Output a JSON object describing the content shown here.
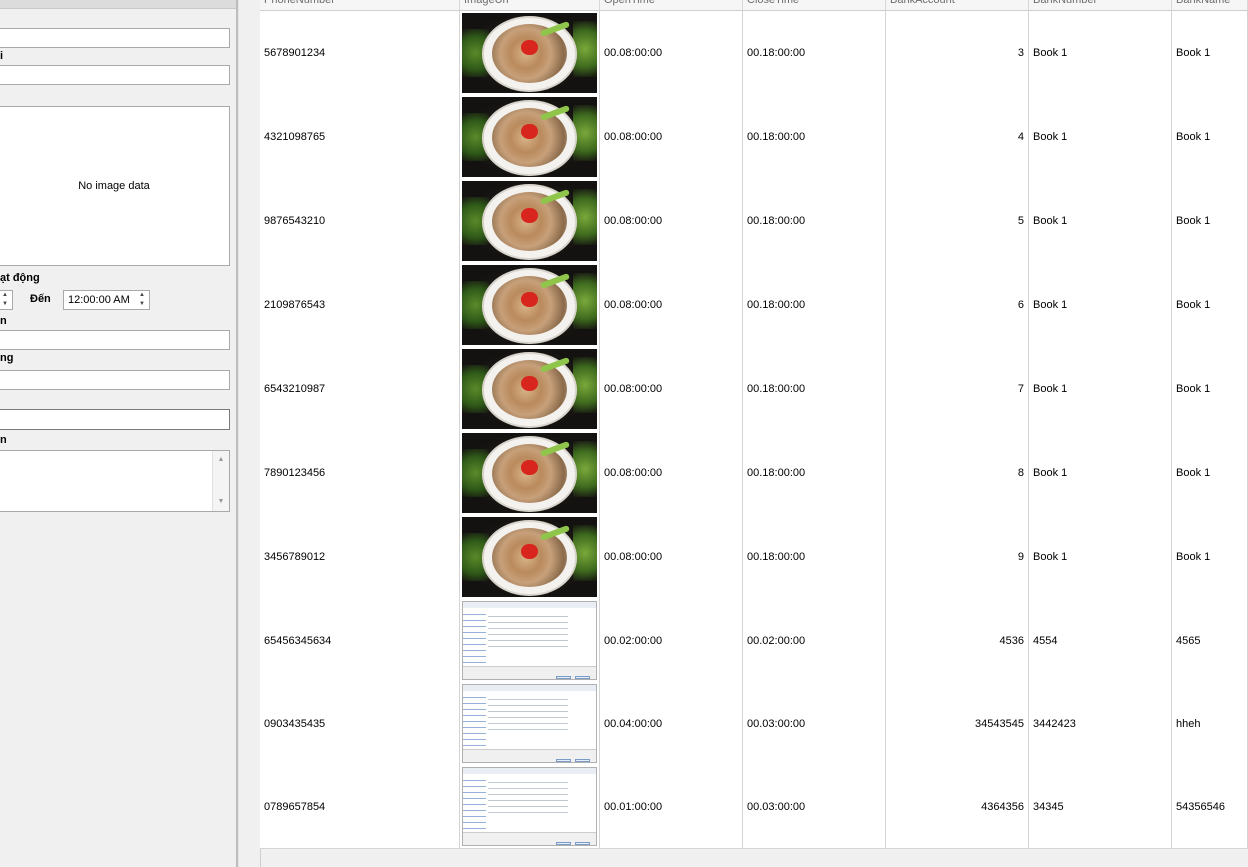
{
  "form": {
    "field_label_1": "i",
    "no_image_text": "No image data",
    "hours_label": "ạt động",
    "to_label": "Đến",
    "to_time_value": "12:00:00 AM",
    "field_label_2": "n",
    "field_label_3": "ng",
    "field_label_4": "n"
  },
  "grid": {
    "columns": [
      {
        "key": "phone",
        "label": "PhoneNumber"
      },
      {
        "key": "image",
        "label": "ImageUrl"
      },
      {
        "key": "open",
        "label": "OpenTime"
      },
      {
        "key": "close",
        "label": "CloseTime"
      },
      {
        "key": "bank_account",
        "label": "BankAccount"
      },
      {
        "key": "bank_number",
        "label": "BankNumber"
      },
      {
        "key": "bank_name",
        "label": "BankName"
      }
    ],
    "rows": [
      {
        "phone": "5678901234",
        "image": "food-photo",
        "open": "00.08:00:00",
        "close": "00.18:00:00",
        "bank_account": "3",
        "bank_number": "Book 1",
        "bank_name": "Book 1"
      },
      {
        "phone": "4321098765",
        "image": "food-photo",
        "open": "00.08:00:00",
        "close": "00.18:00:00",
        "bank_account": "4",
        "bank_number": "Book 1",
        "bank_name": "Book 1"
      },
      {
        "phone": "9876543210",
        "image": "food-photo",
        "open": "00.08:00:00",
        "close": "00.18:00:00",
        "bank_account": "5",
        "bank_number": "Book 1",
        "bank_name": "Book 1"
      },
      {
        "phone": "2109876543",
        "image": "food-photo",
        "open": "00.08:00:00",
        "close": "00.18:00:00",
        "bank_account": "6",
        "bank_number": "Book 1",
        "bank_name": "Book 1"
      },
      {
        "phone": "6543210987",
        "image": "food-photo",
        "open": "00.08:00:00",
        "close": "00.18:00:00",
        "bank_account": "7",
        "bank_number": "Book 1",
        "bank_name": "Book 1"
      },
      {
        "phone": "7890123456",
        "image": "food-photo",
        "open": "00.08:00:00",
        "close": "00.18:00:00",
        "bank_account": "8",
        "bank_number": "Book 1",
        "bank_name": "Book 1"
      },
      {
        "phone": "3456789012",
        "image": "food-photo",
        "open": "00.08:00:00",
        "close": "00.18:00:00",
        "bank_account": "9",
        "bank_number": "Book 1",
        "bank_name": "Book 1"
      },
      {
        "phone": "65456345634",
        "image": "screenshot",
        "open": "00.02:00:00",
        "close": "00.02:00:00",
        "bank_account": "4536",
        "bank_number": "4554",
        "bank_name": "4565"
      },
      {
        "phone": "0903435435",
        "image": "screenshot",
        "open": "00.04:00:00",
        "close": "00.03:00:00",
        "bank_account": "34543545",
        "bank_number": "3442423",
        "bank_name": "hheh"
      },
      {
        "phone": "0789657854",
        "image": "screenshot",
        "open": "00.01:00:00",
        "close": "00.03:00:00",
        "bank_account": "4364356",
        "bank_number": "34345",
        "bank_name": "54356546"
      }
    ]
  }
}
